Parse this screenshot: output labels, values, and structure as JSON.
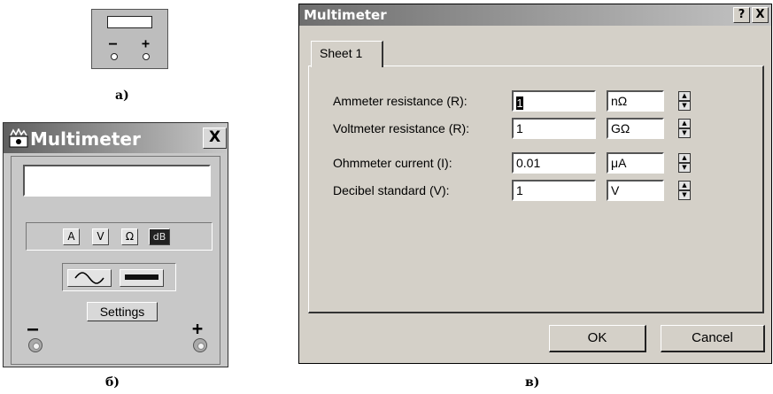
{
  "icon_a": {
    "minus_sign": "–",
    "plus_sign": "+"
  },
  "caption_a": "а)",
  "caption_b": "б)",
  "caption_v": "в)",
  "panel": {
    "title": "Multimeter",
    "close_label": "X",
    "modes": [
      "A",
      "V",
      "Ω",
      "dB"
    ],
    "selected_mode": "dB",
    "signal_types": [
      "ac-sine-icon",
      "dc-bar-icon"
    ],
    "settings_label": "Settings",
    "minus_sign": "–",
    "plus_sign": "+"
  },
  "dialog": {
    "title": "Multimeter",
    "help_label": "?",
    "close_label": "X",
    "tab_label": "Sheet 1",
    "rows": [
      {
        "label": "Ammeter resistance (R):",
        "value": "1",
        "unit": "nΩ"
      },
      {
        "label": "Voltmeter resistance (R):",
        "value": "1",
        "unit": "GΩ"
      },
      {
        "label": "Ohmmeter current (I):",
        "value": "0.01",
        "unit": "μA"
      },
      {
        "label": "Decibel standard (V):",
        "value": "1",
        "unit": "V"
      }
    ],
    "ok_label": "OK",
    "cancel_label": "Cancel"
  }
}
